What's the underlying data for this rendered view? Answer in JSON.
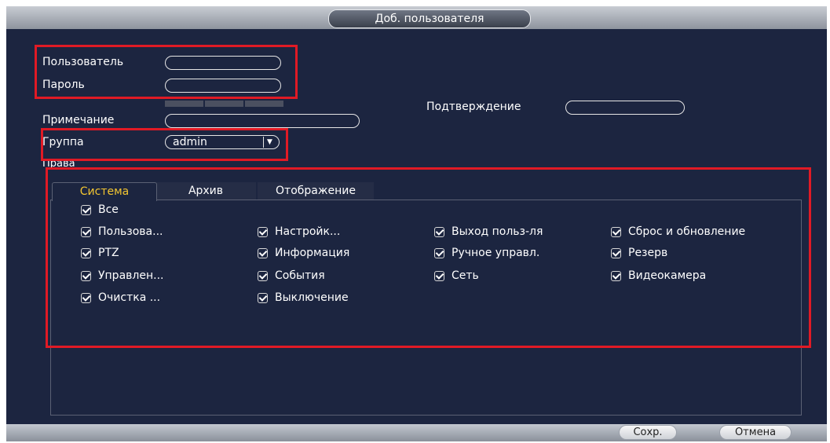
{
  "window": {
    "title": "Доб. пользователя"
  },
  "form": {
    "user_label": "Пользователь",
    "user_value": "",
    "password_label": "Пароль",
    "password_value": "",
    "confirm_label": "Подтверждение",
    "confirm_value": "",
    "note_label": "Примечание",
    "note_value": "",
    "group_label": "Группа",
    "group_value": "admin",
    "rights_label": "Права"
  },
  "tabs": [
    {
      "label": "Система",
      "active": true
    },
    {
      "label": "Архив",
      "active": false
    },
    {
      "label": "Отображение",
      "active": false
    }
  ],
  "permissions": {
    "all": "Все",
    "items": [
      "Пользова...",
      "Настройк...",
      "Выход польз-ля",
      "Сброс и обновление",
      "PTZ",
      "Информация",
      "Ручное управл.",
      "Резерв",
      "Управлен...",
      "События",
      "Сеть",
      "Видеокамера",
      "Очистка ...",
      "Выключение"
    ]
  },
  "buttons": {
    "save": "Сохр.",
    "cancel": "Отмена"
  },
  "colors": {
    "background": "#1c2540",
    "active_tab": "#f2c531",
    "highlight": "#e01a25"
  }
}
